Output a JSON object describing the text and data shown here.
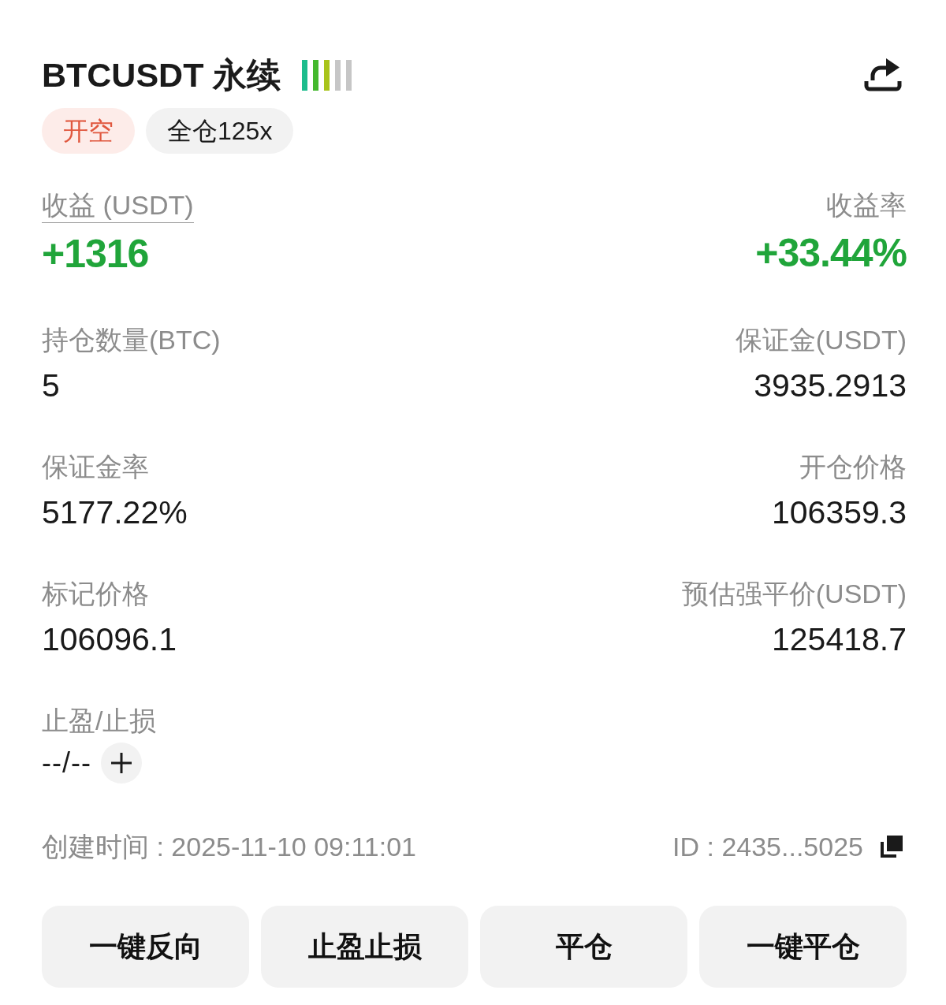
{
  "header": {
    "title": "BTCUSDT 永续",
    "meter": {
      "level": 0.6
    }
  },
  "tags": [
    {
      "kind": "side",
      "label": "开空"
    },
    {
      "kind": "margin",
      "label": "全仓125x"
    }
  ],
  "pnl": [
    {
      "label": "收益 (USDT)",
      "value": "+1316",
      "underlined": true
    },
    {
      "label": "收益率",
      "value": "+33.44%",
      "underlined": false
    }
  ],
  "stats": [
    {
      "kind": "value",
      "label": "持仓数量(BTC)",
      "value": "5"
    },
    {
      "kind": "value",
      "label": "保证金(USDT)",
      "value": "3935.2913"
    },
    {
      "kind": "value",
      "label": "保证金率",
      "value": "5177.22%"
    },
    {
      "kind": "value",
      "label": "开仓价格",
      "value": "106359.3"
    },
    {
      "kind": "value",
      "label": "标记价格",
      "value": "106096.1"
    },
    {
      "kind": "value",
      "label": "预估强平价(USDT)",
      "value": "125418.7"
    },
    {
      "kind": "editable",
      "label": "止盈/止损",
      "value": "--/--"
    }
  ],
  "footer": {
    "created": "创建时间 : 2025-11-10 09:11:01",
    "id": "ID : 2435...5025"
  },
  "buttons": [
    "一键反向",
    "止盈止损",
    "平仓",
    "一键平仓"
  ]
}
